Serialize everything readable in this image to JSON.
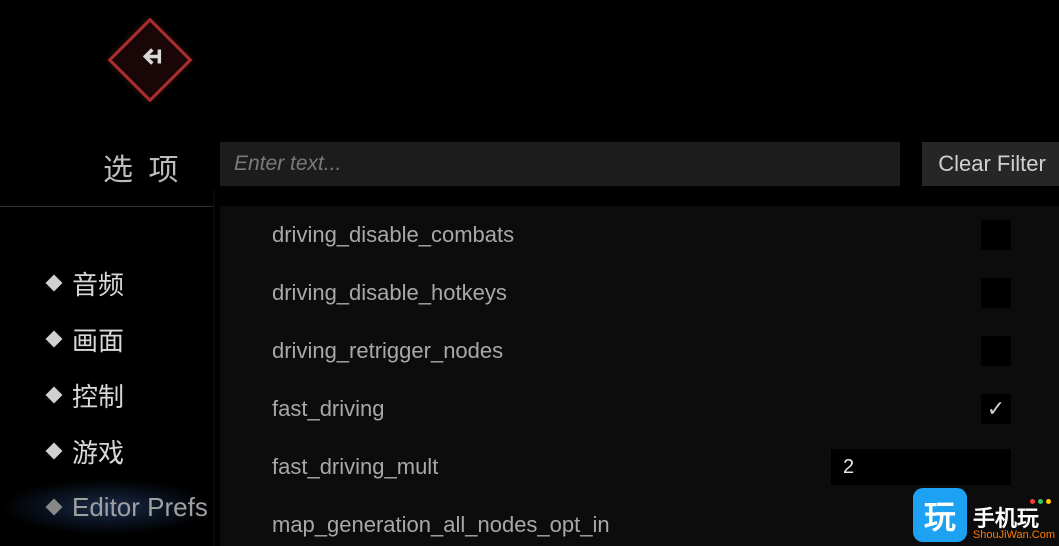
{
  "title": "选 项",
  "search": {
    "placeholder": "Enter text..."
  },
  "clear_filter_label": "Clear Filter",
  "sidebar": {
    "items": [
      {
        "label": "音频"
      },
      {
        "label": "画面"
      },
      {
        "label": "控制"
      },
      {
        "label": "游戏"
      },
      {
        "label": "Editor Prefs"
      }
    ],
    "active_index": 4
  },
  "settings": [
    {
      "key": "driving_disable_combats",
      "control": "checkbox",
      "checked": false
    },
    {
      "key": "driving_disable_hotkeys",
      "control": "checkbox",
      "checked": false
    },
    {
      "key": "driving_retrigger_nodes",
      "control": "checkbox",
      "checked": false
    },
    {
      "key": "fast_driving",
      "control": "checkbox",
      "checked": true
    },
    {
      "key": "fast_driving_mult",
      "control": "number",
      "value": "2"
    },
    {
      "key": "map_generation_all_nodes_opt_in",
      "control": "checkbox",
      "checked": false
    }
  ],
  "icons": {
    "check_glyph": "✓"
  },
  "watermark": {
    "box": "玩",
    "main": "手机玩",
    "sub": "ShouJiWan.Com",
    "dot_colors": [
      "#ff3b30",
      "#34c759",
      "#ffcc00"
    ]
  }
}
